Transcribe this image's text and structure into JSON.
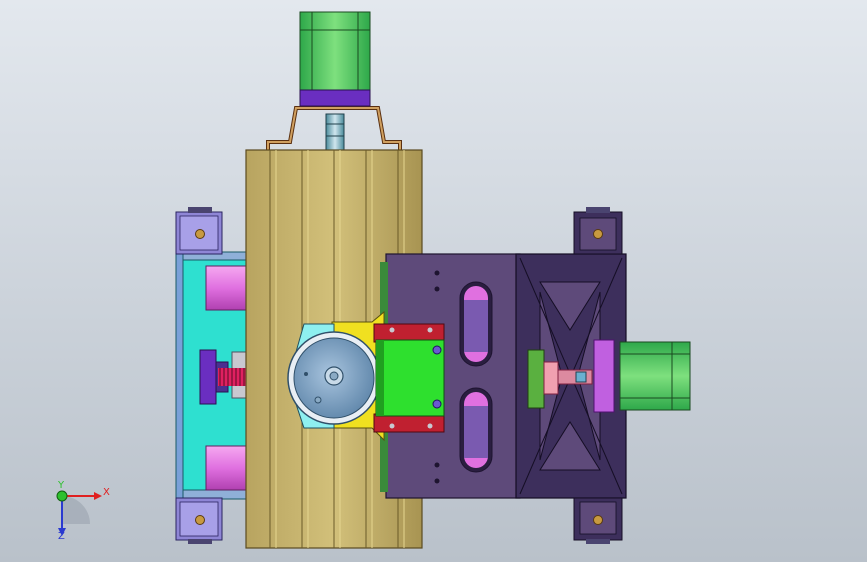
{
  "view": {
    "background_top": "#e3e8ee",
    "background_bottom": "#b9c1ca"
  },
  "triad": {
    "x_label": "X",
    "y_label": "Y",
    "z_label": "Z",
    "x_color": "#e02020",
    "y_color": "#2ec02e",
    "z_color": "#2a3ad0"
  },
  "parts": {
    "extrusion_color": "#c4b26c",
    "slider_color": "#5e4a7a",
    "bracket_color": "#3d2f5c",
    "left_plate_color": "#2ee0d0",
    "motor_green": "#3cc85a",
    "motor_purple": "#6a2ec0",
    "block_green": "#2ee02e",
    "red_block": "#c02030",
    "yellow_mount": "#f0e020",
    "magenta": "#e060e0"
  }
}
